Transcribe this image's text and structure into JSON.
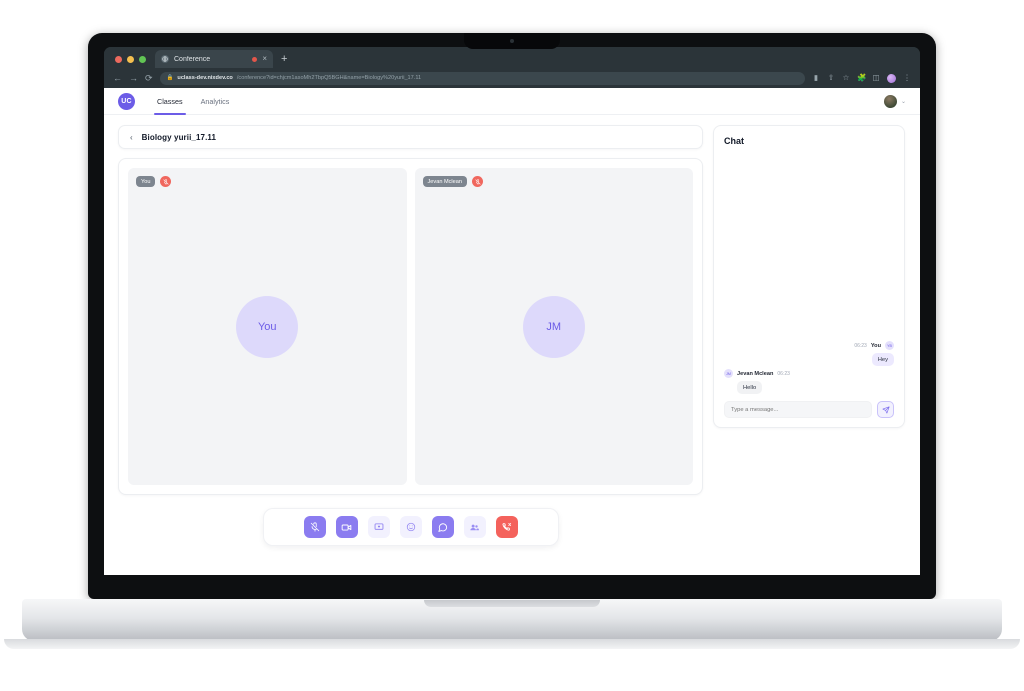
{
  "browser": {
    "tab": {
      "title": "Conference",
      "favicon_icon": "globe-icon",
      "recording_dot": true,
      "close_label": "×"
    },
    "new_tab_label": "+",
    "nav": {
      "back": "←",
      "forward": "→",
      "reload": "⟳"
    },
    "url": {
      "lock_icon": "lock-icon",
      "domain": "uclass-dev.nixdev.co",
      "path": "/conference?id=chjcm1asoMh2TbpQ5BGH&name=Biology%20yurii_17.11"
    },
    "toolbar_icons": [
      "media-icon",
      "share-icon",
      "bookmark-star-icon",
      "extensions-puzzle-icon",
      "sidepanel-icon",
      "profile-avatar-icon",
      "kebab-menu-icon"
    ]
  },
  "app": {
    "logo_text": "UC",
    "nav_tabs": [
      {
        "label": "Classes",
        "active": true
      },
      {
        "label": "Analytics",
        "active": false
      }
    ],
    "account_chevron": "⌄"
  },
  "room": {
    "back_icon": "chevron-left-icon",
    "title": "Biology yurii_17.11"
  },
  "tiles": [
    {
      "name": "You",
      "avatar_initials": "You",
      "muted": true
    },
    {
      "name": "Jevan Mclean",
      "avatar_initials": "JM",
      "muted": true
    }
  ],
  "controls": [
    {
      "name": "microphone-off",
      "icon": "mic-off-icon",
      "state": "solid"
    },
    {
      "name": "camera",
      "icon": "camera-icon",
      "state": "solid"
    },
    {
      "name": "screen-share",
      "icon": "screen-share-icon",
      "state": "soft"
    },
    {
      "name": "reactions",
      "icon": "emoji-icon",
      "state": "soft"
    },
    {
      "name": "chat",
      "icon": "chat-bubble-icon",
      "state": "solid"
    },
    {
      "name": "participants",
      "icon": "people-icon",
      "state": "soft"
    },
    {
      "name": "end-call",
      "icon": "phone-hangup-icon",
      "state": "danger"
    }
  ],
  "chat": {
    "title": "Chat",
    "messages": [
      {
        "author": "You",
        "initials": "YB",
        "time": "06:23",
        "text": "Hey",
        "direction": "out"
      },
      {
        "author": "Jevan Mclean",
        "initials": "JM",
        "time": "06:23",
        "text": "Hello",
        "direction": "in"
      }
    ],
    "input_placeholder": "Type a message...",
    "send_icon": "send-paper-plane-icon"
  },
  "colors": {
    "accent": "#6c5ce7",
    "accent_soft": "#8b7cf0",
    "danger": "#f4625c",
    "bubble_out": "#ece9fe",
    "bubble_in": "#f1f2f4",
    "tile_bg": "#f3f4f6"
  }
}
